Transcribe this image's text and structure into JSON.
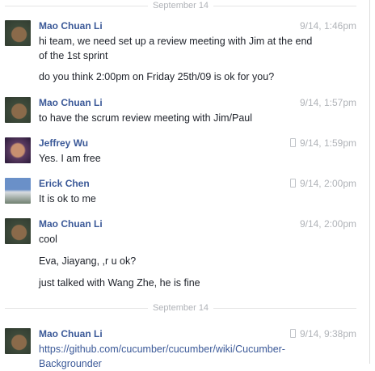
{
  "dividers": [
    "September 14",
    "September 14"
  ],
  "messages": [
    {
      "name": "Mao Chuan Li",
      "time": "9/14, 1:46pm",
      "mobile": false,
      "lines": [
        "hi team, we need set up a review meeting with Jim at the end of the 1st sprint",
        "do you think 2:00pm on Friday 25th/09 is ok for you?"
      ]
    },
    {
      "name": "Mao Chuan Li",
      "time": "9/14, 1:57pm",
      "mobile": false,
      "lines": [
        "to have the scrum review meeting with Jim/Paul"
      ]
    },
    {
      "name": "Jeffrey Wu",
      "time": "9/14, 1:59pm",
      "mobile": true,
      "lines": [
        "Yes. I am free"
      ]
    },
    {
      "name": "Erick Chen",
      "time": "9/14, 2:00pm",
      "mobile": true,
      "lines": [
        "It is ok to me"
      ]
    },
    {
      "name": "Mao Chuan Li",
      "time": "9/14, 2:00pm",
      "mobile": false,
      "lines": [
        "cool",
        "Eva, Jiayang, ,r u ok?",
        "just talked with Wang Zhe, he is fine"
      ]
    },
    {
      "name": "Mao Chuan Li",
      "time": "9/14, 9:38pm",
      "mobile": true,
      "lines": [
        "https://github.com/cucumber/cucumber/wiki/Cucumber-Backgrounder"
      ]
    }
  ]
}
